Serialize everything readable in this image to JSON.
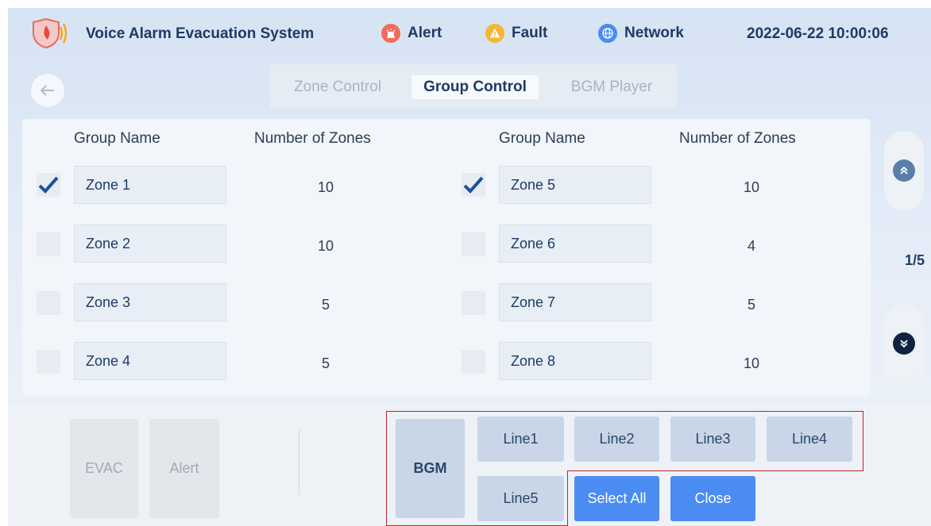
{
  "header": {
    "app_title": "Voice Alarm Evacuation System",
    "status": [
      {
        "label": "Alert",
        "icon": "alert-icon",
        "color": "#f26b5b"
      },
      {
        "label": "Fault",
        "icon": "fault-icon",
        "color": "#f5b731"
      },
      {
        "label": "Network",
        "icon": "network-icon",
        "color": "#4a8cf2"
      }
    ],
    "datetime": "2022-06-22  10:00:06"
  },
  "tabs": [
    "Zone Control",
    "Group Control",
    "BGM Player"
  ],
  "active_tab": "Group Control",
  "table": {
    "col_group_name": "Group Name",
    "col_number_of_zones": "Number of Zones",
    "left": [
      {
        "name": "Zone 1",
        "zones": "10",
        "checked": true
      },
      {
        "name": "Zone 2",
        "zones": "10",
        "checked": false
      },
      {
        "name": "Zone 3",
        "zones": "5",
        "checked": false
      },
      {
        "name": "Zone 4",
        "zones": "5",
        "checked": false
      }
    ],
    "right": [
      {
        "name": "Zone 5",
        "zones": "10",
        "checked": true
      },
      {
        "name": "Zone 6",
        "zones": "4",
        "checked": false
      },
      {
        "name": "Zone 7",
        "zones": "5",
        "checked": false
      },
      {
        "name": "Zone 8",
        "zones": "10",
        "checked": false
      }
    ]
  },
  "pager": {
    "indicator": "1/5"
  },
  "bottom": {
    "evac": "EVAC",
    "alert": "Alert",
    "bgm": "BGM",
    "lines": [
      "Line1",
      "Line2",
      "Line3",
      "Line4",
      "Line5"
    ],
    "select_all": "Select All",
    "close": "Close"
  },
  "colors": {
    "accent": "#4a8cf2",
    "title_text": "#1d3b66",
    "highlight_border": "#c0222a"
  }
}
